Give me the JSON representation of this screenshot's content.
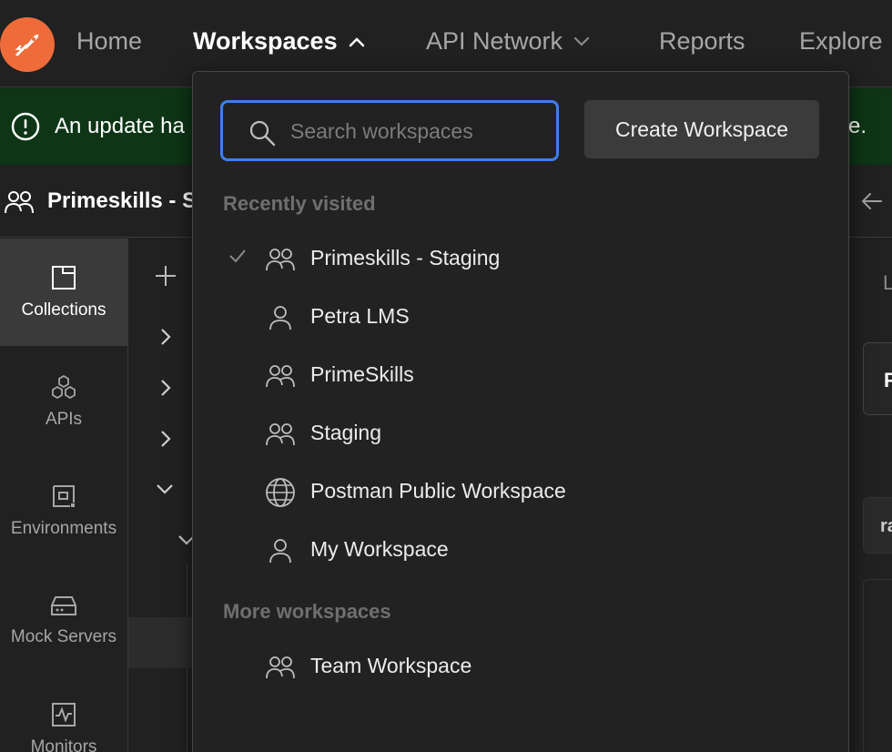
{
  "nav": {
    "home": "Home",
    "workspaces": "Workspaces",
    "api_network": "API Network",
    "reports": "Reports",
    "explore": "Explore"
  },
  "banner": {
    "text_start": "An update ha",
    "text_end": "ate."
  },
  "workspace_header": {
    "name": "Primeskills - S"
  },
  "sidebar": {
    "items": [
      {
        "label": "Collections",
        "icon": "collections-icon"
      },
      {
        "label": "APIs",
        "icon": "apis-icon"
      },
      {
        "label": "Environments",
        "icon": "environments-icon"
      },
      {
        "label": "Mock Servers",
        "icon": "mock-servers-icon"
      },
      {
        "label": "Monitors",
        "icon": "monitors-icon"
      }
    ]
  },
  "right_edge": {
    "label_l": "L",
    "label_p": "P",
    "label_ra": "ra"
  },
  "dropdown": {
    "search_placeholder": "Search workspaces",
    "create_button": "Create Workspace",
    "recently_visited_label": "Recently visited",
    "recent": [
      {
        "label": "Primeskills - Staging",
        "icon": "team-icon",
        "selected": true
      },
      {
        "label": "Petra LMS",
        "icon": "person-icon",
        "selected": false
      },
      {
        "label": "PrimeSkills",
        "icon": "team-icon",
        "selected": false
      },
      {
        "label": "Staging",
        "icon": "team-icon",
        "selected": false
      },
      {
        "label": "Postman Public Workspace",
        "icon": "globe-icon",
        "selected": false
      },
      {
        "label": "My Workspace",
        "icon": "person-icon",
        "selected": false
      }
    ],
    "more_label": "More workspaces",
    "more": [
      {
        "label": "Team Workspace",
        "icon": "team-icon"
      }
    ]
  },
  "colors": {
    "accent_blue": "#3d7ff0",
    "postman_orange": "#ef6c3a",
    "banner_green": "#0e3516"
  }
}
